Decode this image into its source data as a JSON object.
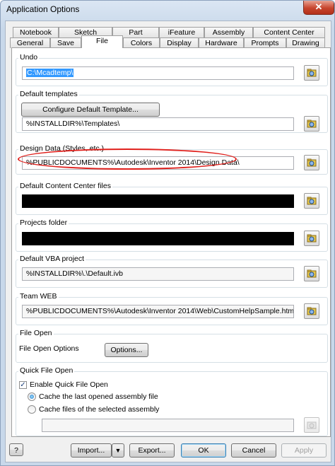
{
  "window": {
    "title": "Application Options",
    "close_label": "✕"
  },
  "tabs_top": [
    "Notebook",
    "Sketch",
    "Part",
    "iFeature",
    "Assembly",
    "Content Center"
  ],
  "tabs_bottom": [
    "General",
    "Save",
    "File",
    "Colors",
    "Display",
    "Hardware",
    "Prompts",
    "Drawing"
  ],
  "active_tab": "File",
  "groups": {
    "undo": {
      "label": "Undo",
      "value": "C:\\Mcadtemp\\"
    },
    "default_templates": {
      "label": "Default templates",
      "configure_button": "Configure Default Template...",
      "value": "%INSTALLDIR%\\Templates\\"
    },
    "design_data": {
      "label": "Design Data (Styles, etc.)",
      "value": "%PUBLICDOCUMENTS%\\Autodesk\\Inventor 2014\\Design Data\\"
    },
    "content_center": {
      "label": "Default Content Center files",
      "value": ""
    },
    "projects": {
      "label": "Projects folder",
      "value": ""
    },
    "vba": {
      "label": "Default VBA project",
      "value": "%INSTALLDIR%\\.\\Default.ivb"
    },
    "team_web": {
      "label": "Team WEB",
      "value": "%PUBLICDOCUMENTS%\\Autodesk\\Inventor 2014\\Web\\CustomHelpSample.htm"
    },
    "file_open": {
      "label": "File Open",
      "options_label": "File Open Options",
      "options_button": "Options..."
    },
    "quick_file_open": {
      "label": "Quick File Open",
      "enable_label": "Enable Quick File Open",
      "enabled": true,
      "radio_1": "Cache the last opened assembly file",
      "radio_2": "Cache files of the selected assembly",
      "selected_radio": 1,
      "path_value": ""
    }
  },
  "footer": {
    "help": "?",
    "import": "Import...",
    "export": "Export...",
    "ok": "OK",
    "cancel": "Cancel",
    "apply": "Apply"
  },
  "colors": {
    "annotation": "#e0201c",
    "selection": "#3399ff"
  },
  "icons": [
    "close-icon",
    "browse-folder-icon",
    "help-icon",
    "dropdown-arrow-icon",
    "checkmark-icon"
  ]
}
